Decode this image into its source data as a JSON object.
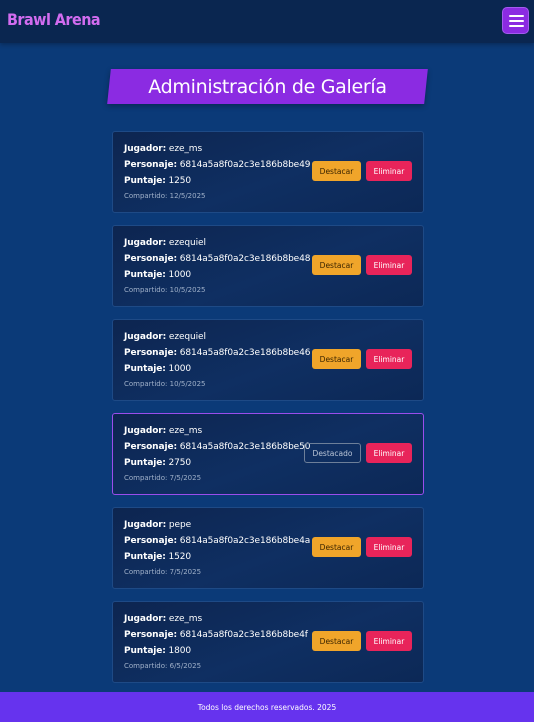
{
  "app": {
    "brand": "Brawl Arena",
    "menu_icon": "hamburger-icon"
  },
  "page": {
    "title": "Administración de Galería"
  },
  "labels": {
    "player": "Jugador:",
    "character": "Personaje:",
    "score": "Puntaje:",
    "shared_prefix": "Compartido:",
    "highlight_button": "Destacar",
    "featured_button": "Destacado",
    "delete_button": "Eliminar"
  },
  "cards": [
    {
      "player": "eze_ms",
      "character": "6814a5a8f0a2c3e186b8be49",
      "score": "1250",
      "shared": "12/5/2025",
      "featured": false
    },
    {
      "player": "ezequiel",
      "character": "6814a5a8f0a2c3e186b8be48",
      "score": "1000",
      "shared": "10/5/2025",
      "featured": false
    },
    {
      "player": "ezequiel",
      "character": "6814a5a8f0a2c3e186b8be46",
      "score": "1000",
      "shared": "10/5/2025",
      "featured": false
    },
    {
      "player": "eze_ms",
      "character": "6814a5a8f0a2c3e186b8be50",
      "score": "2750",
      "shared": "7/5/2025",
      "featured": true
    },
    {
      "player": "pepe",
      "character": "6814a5a8f0a2c3e186b8be4a",
      "score": "1520",
      "shared": "7/5/2025",
      "featured": false
    },
    {
      "player": "eze_ms",
      "character": "6814a5a8f0a2c3e186b8be4f",
      "score": "1800",
      "shared": "6/5/2025",
      "featured": false
    }
  ],
  "footer": {
    "text": "Todos los derechos reservados. 2025"
  },
  "colors": {
    "background": "#0b3a78",
    "header": "#0a2650",
    "brand": "#d26cf0",
    "accent_purple": "#8b2be2",
    "highlight_orange": "#f0a52a",
    "delete_pink": "#e8245a",
    "footer": "#6633ee"
  }
}
